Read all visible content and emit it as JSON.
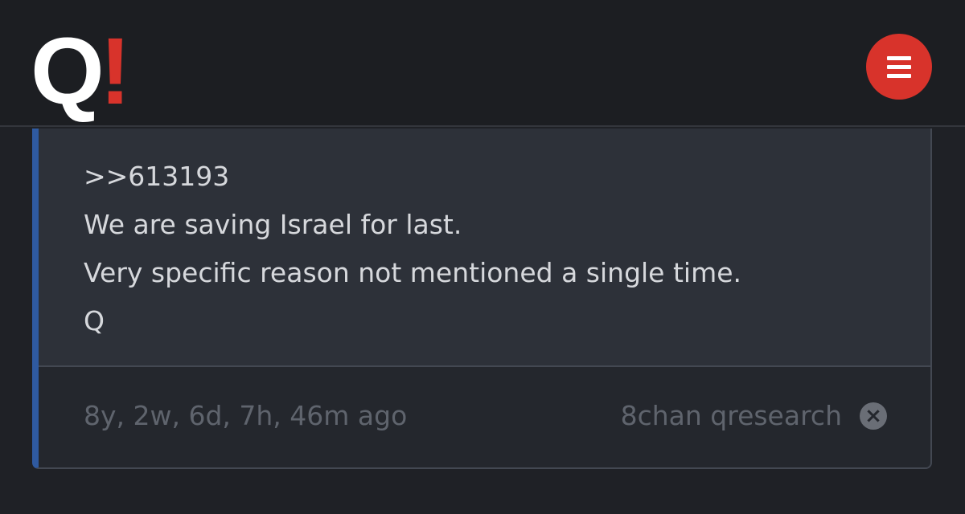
{
  "header": {
    "logo": {
      "letter": "Q",
      "mark": "!"
    },
    "menu_icon": "hamburger-menu-icon"
  },
  "post": {
    "lines": [
      ">>613193",
      "We are saving Israel for last.",
      "Very specific reason not mentioned a single time.",
      "Q"
    ],
    "timestamp": "8y, 2w, 6d, 7h, 46m ago",
    "source": "8chan qresearch",
    "close_icon": "close-circle-icon"
  },
  "colors": {
    "background": "#1f2126",
    "accent_red": "#d8332b",
    "accent_blue": "#2f5aa0",
    "card": "#2d3139"
  }
}
